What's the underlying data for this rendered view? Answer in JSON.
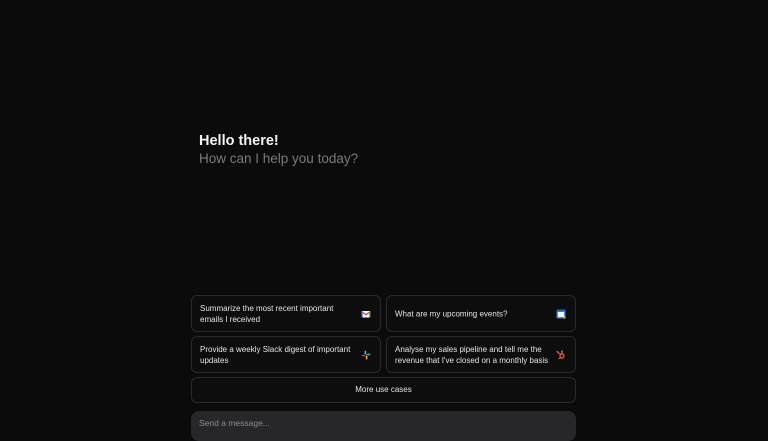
{
  "greeting": {
    "title": "Hello there!",
    "subtitle": "How can I help you today?"
  },
  "suggestions": [
    {
      "label": "Summarize the most recent important emails I received",
      "icon": "gmail-icon"
    },
    {
      "label": "What are my upcoming events?",
      "icon": "google-calendar-icon"
    },
    {
      "label": "Provide a weekly Slack digest of important updates",
      "icon": "slack-icon"
    },
    {
      "label": "Analyse my sales pipeline and tell me the revenue that I've closed on a monthly basis",
      "icon": "hubspot-icon"
    }
  ],
  "more_button": {
    "label": "More use cases"
  },
  "composer": {
    "placeholder": "Send a message..."
  },
  "colors": {
    "background": "#0b0b0c",
    "card_border": "#2a2a2d",
    "composer_bg": "#27272a",
    "hubspot": "#ff5c35"
  }
}
